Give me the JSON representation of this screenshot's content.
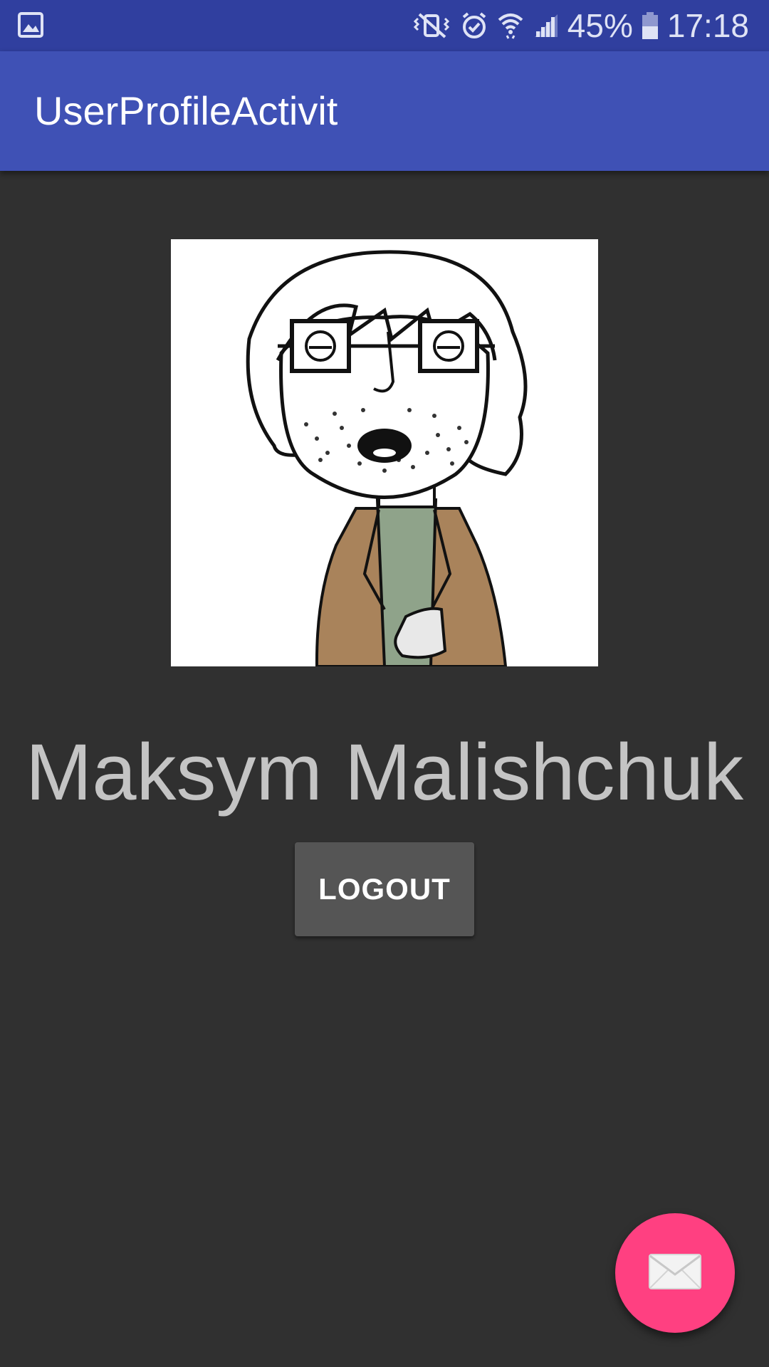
{
  "status_bar": {
    "battery_percent": "45%",
    "time": "17:18",
    "icons": [
      "gallery-notification-icon",
      "vibrate-mute-icon",
      "alarm-icon",
      "wifi-icon",
      "signal-icon",
      "battery-icon"
    ]
  },
  "app_bar": {
    "title": "UserProfileActivit"
  },
  "profile": {
    "avatar_icon": "user-avatar-image",
    "name": "Maksym Malishchuk"
  },
  "actions": {
    "logout_label": "LOGOUT",
    "fab_icon": "mail-icon"
  },
  "colors": {
    "status_bar": "#303F9F",
    "app_bar": "#3F51B5",
    "background": "#303030",
    "button": "#555555",
    "fab": "#FF4081",
    "name_text": "#c4c4c4"
  }
}
